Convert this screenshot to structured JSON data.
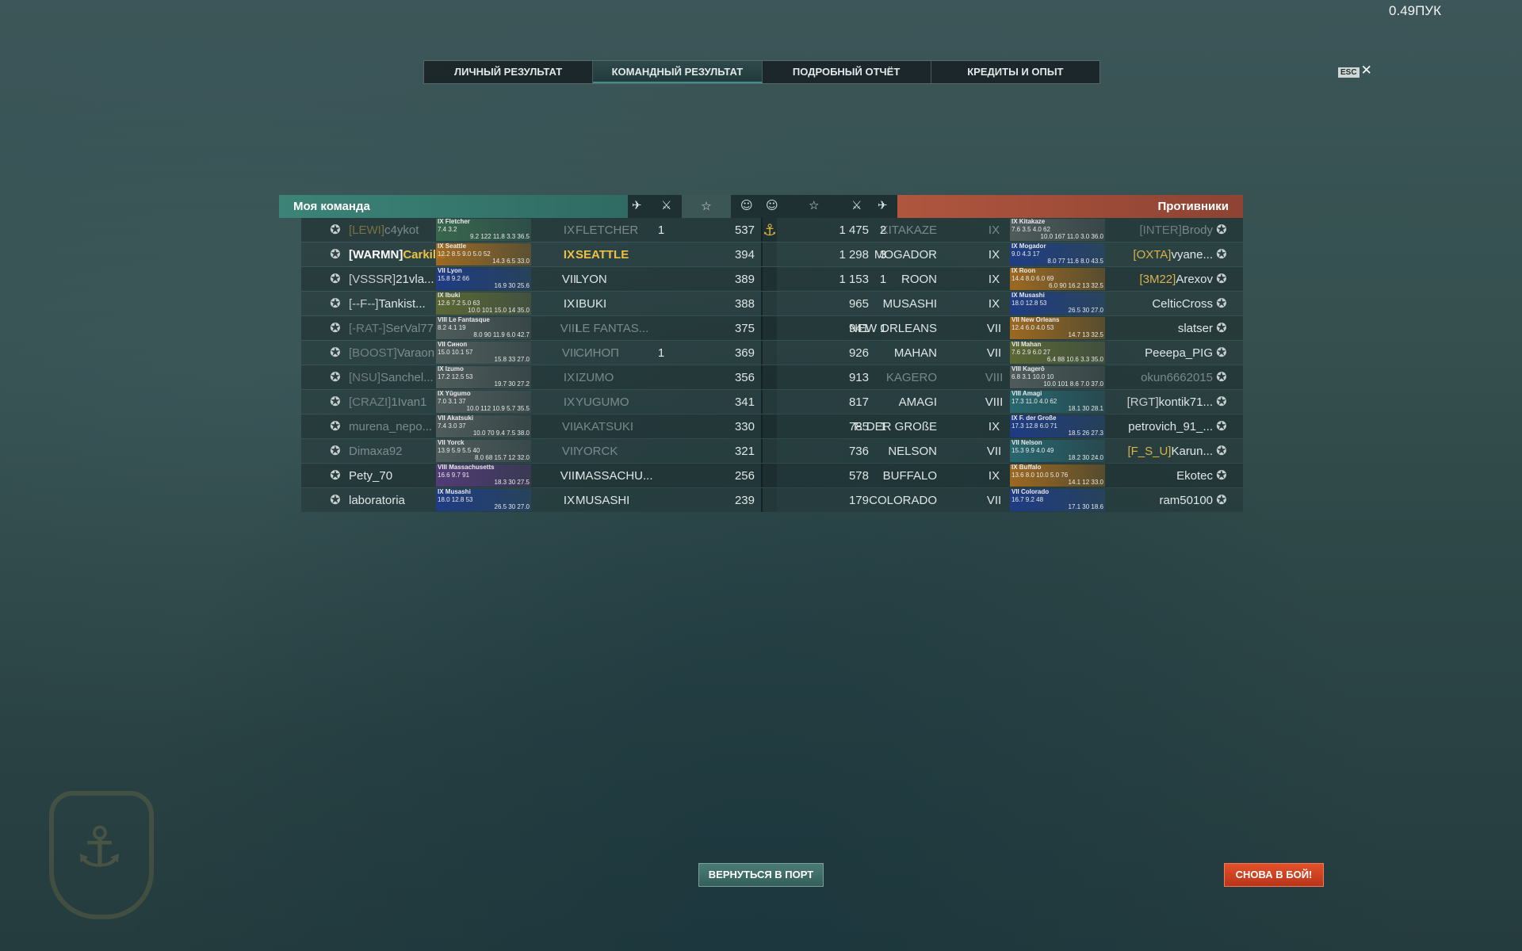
{
  "ping": "0.49ПУК",
  "tabs": [
    "ЛИЧНЫЙ РЕЗУЛЬТАТ",
    "КОМАНДНЫЙ РЕЗУЛЬТАТ",
    "ПОДРОБНЫЙ ОТЧЁТ",
    "КРЕДИТЫ И ОПЫТ"
  ],
  "active_tab": "КОМАНДНЫЙ РЕЗУЛЬТАТ",
  "esc_key": "ESC",
  "close_glyph": "✕",
  "team_header": "Моя команда",
  "enemy_header": "Противники",
  "buttons": {
    "to_port": "ВЕРНУТЬСЯ В ПОРТ",
    "battle_again": "СНОВА В БОЙ!"
  },
  "my_team": [
    {
      "clan": "[LEWI]",
      "name": "c4ykot",
      "tier": "IX",
      "ship": "FLETCHER",
      "kills": "1",
      "score": "537",
      "card": {
        "name": "IX Fletcher",
        "s1": "7.4 3.2",
        "s2": "9.2 122 11.8 3.3 36.5"
      },
      "dim": true
    },
    {
      "clan": "[WARMN]",
      "name": "Carkiller1...",
      "tier": "IX",
      "ship": "SEATTLE",
      "kills": "",
      "score": "394",
      "card": {
        "name": "IX Seattle",
        "s1": "12.2 8.5 9.0 5.0 52",
        "s2": "14.3 6.5 33.0"
      },
      "self": true
    },
    {
      "clan": "[VSSSR]",
      "name": "21vla...",
      "tier": "VII",
      "ship": "LYON",
      "kills": "",
      "score": "389",
      "card": {
        "name": "VII Lyon",
        "s1": "15.8 9.2 66",
        "s2": "16.9 30 25.6"
      }
    },
    {
      "clan": "[--F--]",
      "name": "Tankist...",
      "tier": "IX",
      "ship": "IBUKI",
      "kills": "",
      "score": "388",
      "card": {
        "name": "IX Ibuki",
        "s1": "12.6 7.2 5.0 63",
        "s2": "10.0 101 15.0 14 35.0"
      }
    },
    {
      "clan": "[-RAT-]",
      "name": "SerVal77",
      "tier": "VIII",
      "ship": "LE FANTAS...",
      "kills": "",
      "score": "375",
      "card": {
        "name": "VIII Le Fantasque",
        "s1": "8.2 4.1 19",
        "s2": "8.0 90 11.9 6.0 42.7"
      },
      "dim": true
    },
    {
      "clan": "[BOOST]",
      "name": "Varaon",
      "tier": "VII",
      "ship": "СИНОП",
      "kills": "1",
      "score": "369",
      "card": {
        "name": "VII Синоп",
        "s1": "15.0 10.1 57",
        "s2": "15.8 33 27.0"
      },
      "dim": true
    },
    {
      "clan": "[NSU]",
      "name": "Sanchel...",
      "tier": "IX",
      "ship": "IZUMO",
      "kills": "",
      "score": "356",
      "card": {
        "name": "IX Izumo",
        "s1": "17.2 12.5 53",
        "s2": "19.7 30 27.2"
      },
      "dim": true
    },
    {
      "clan": "[CRAZI]",
      "name": "1Ivan1",
      "tier": "IX",
      "ship": "YUGUMO",
      "kills": "",
      "score": "341",
      "card": {
        "name": "IX Yūgumo",
        "s1": "7.0 3.1 37",
        "s2": "10.0 112 10.9 5.7 35.5"
      },
      "dim": true
    },
    {
      "clan": "",
      "name": "murena_nepo...",
      "tier": "VII",
      "ship": "AKATSUKI",
      "kills": "",
      "score": "330",
      "card": {
        "name": "VII Akatsuki",
        "s1": "7.4 3.0 37",
        "s2": "10.0 70 9.4 7.5 38.0"
      },
      "dim": true
    },
    {
      "clan": "",
      "name": "Dimaxa92",
      "tier": "VII",
      "ship": "YORCK",
      "kills": "",
      "score": "321",
      "card": {
        "name": "VII Yorck",
        "s1": "13.9 5.9 5.5 40",
        "s2": "8.0 68 15.7 12 32.0"
      },
      "dim": true
    },
    {
      "clan": "",
      "name": "Pety_70",
      "tier": "VIII",
      "ship": "MASSACHU...",
      "kills": "",
      "score": "256",
      "card": {
        "name": "VIII Massachusetts",
        "s1": "16.6 9.7 91",
        "s2": "18.3 30 27.5"
      }
    },
    {
      "clan": "",
      "name": "laboratoria",
      "tier": "IX",
      "ship": "MUSASHI",
      "kills": "",
      "score": "239",
      "card": {
        "name": "IX Musashi",
        "s1": "18.0 12.8 53",
        "s2": "26.5 30 27.0"
      }
    }
  ],
  "enemy_team": [
    {
      "clan": "[INTER]",
      "name": "Brody",
      "tier": "IX",
      "ship": "KITAKAZE",
      "kills": "2",
      "score": "1 475",
      "card": {
        "name": "IX Kitakaze",
        "s1": "7.6 3.5 4.0 62",
        "s2": "10.0 167 11.0 3.0 36.0"
      },
      "dim": true,
      "medal": true
    },
    {
      "clan": "[OXTA]",
      "name": "vyane...",
      "tier": "IX",
      "ship": "MOGADOR",
      "kills": "3",
      "score": "1 298",
      "card": {
        "name": "IX Mogador",
        "s1": "9.0 4.3 17",
        "s2": "8.0 77 11.6 8.0 43.5"
      }
    },
    {
      "clan": "[3M22]",
      "name": "Arexov",
      "tier": "IX",
      "ship": "ROON",
      "kills": "1",
      "score": "1 153",
      "card": {
        "name": "IX Roon",
        "s1": "14.4 8.0 6.0 69",
        "s2": "6.0 90 16.2 13 32.5"
      }
    },
    {
      "clan": "",
      "name": "CelticCross",
      "tier": "IX",
      "ship": "MUSASHI",
      "kills": "",
      "score": "965",
      "card": {
        "name": "IX Musashi",
        "s1": "18.0 12.8 53",
        "s2": "26.5 30 27.0"
      }
    },
    {
      "clan": "",
      "name": "slatser",
      "tier": "VII",
      "ship": "NEW ORLEANS",
      "kills": "1",
      "score": "941",
      "card": {
        "name": "VII New Orleans",
        "s1": "12.4 6.0 4.0 53",
        "s2": "14.7 13 32.5"
      }
    },
    {
      "clan": "",
      "name": "Peeepa_PIG",
      "tier": "VII",
      "ship": "MAHAN",
      "kills": "",
      "score": "926",
      "card": {
        "name": "VII Mahan",
        "s1": "7.6 2.9 6.0 27",
        "s2": "6.4 88 10.6 3.3 35.0"
      }
    },
    {
      "clan": "",
      "name": "okun6662015",
      "tier": "VIII",
      "ship": "KAGERO",
      "kills": "",
      "score": "913",
      "card": {
        "name": "VIII Kagerō",
        "s1": "6.8 3.1 10.0 10",
        "s2": "10.0 101 8.6 7.0 37.0"
      },
      "dim": true
    },
    {
      "clan": "[RGT]",
      "name": "kontik71...",
      "tier": "VIII",
      "ship": "AMAGI",
      "kills": "",
      "score": "817",
      "card": {
        "name": "VIII Amagi",
        "s1": "17.3 11.0 4.0 62",
        "s2": "18.1 30 28.1"
      }
    },
    {
      "clan": "",
      "name": "petrovich_91_...",
      "tier": "IX",
      "ship": "F. DER GROßE",
      "kills": "1",
      "score": "785",
      "card": {
        "name": "IX F. der Große",
        "s1": "17.3 12.8 6.0 71",
        "s2": "18.5 26 27.3"
      }
    },
    {
      "clan": "[F_S_U]",
      "name": "Karun...",
      "tier": "VII",
      "ship": "NELSON",
      "kills": "",
      "score": "736",
      "card": {
        "name": "VII Nelson",
        "s1": "15.3 9.9 4.0 49",
        "s2": "18.2 30 24.0"
      }
    },
    {
      "clan": "",
      "name": "Ekotec",
      "tier": "IX",
      "ship": "BUFFALO",
      "kills": "",
      "score": "578",
      "card": {
        "name": "IX Buffalo",
        "s1": "13.6 8.0 10.0 5.0 76",
        "s2": "14.1 12 33.0"
      }
    },
    {
      "clan": "",
      "name": "ram50100",
      "tier": "VII",
      "ship": "COLORADO",
      "kills": "",
      "score": "179",
      "card": {
        "name": "VII Colorado",
        "s1": "16.7 9.2 48",
        "s2": "17.1 30 18.6"
      }
    }
  ]
}
